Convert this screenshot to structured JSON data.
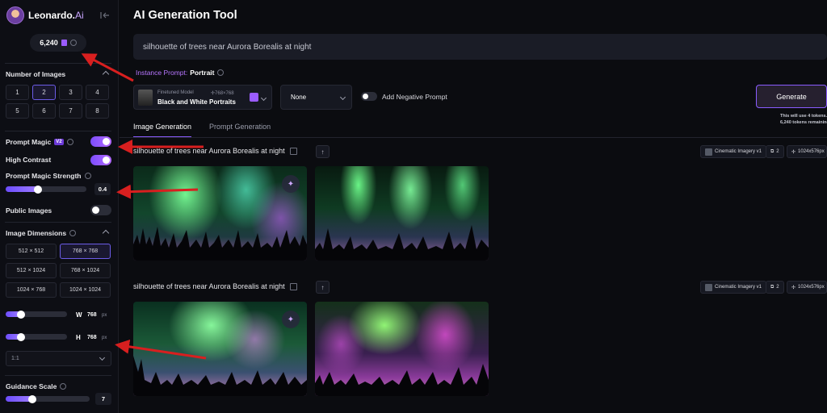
{
  "app": {
    "name": "Leonardo.",
    "name_ai": "Ai",
    "tokens": "6,240"
  },
  "sidebar": {
    "num_images_label": "Number of Images",
    "num_options": [
      "1",
      "2",
      "3",
      "4",
      "5",
      "6",
      "7",
      "8"
    ],
    "num_selected": "2",
    "prompt_magic_label": "Prompt Magic",
    "prompt_magic_badge": "V2",
    "prompt_magic_on": true,
    "high_contrast_label": "High Contrast",
    "high_contrast_on": true,
    "magic_strength_label": "Prompt Magic Strength",
    "magic_strength_value": "0.4",
    "magic_strength_fraction": 0.4,
    "public_images_label": "Public Images",
    "public_images_on": false,
    "dimensions_label": "Image Dimensions",
    "dimensions": [
      "512 × 512",
      "768 × 768",
      "512 × 1024",
      "768 × 1024",
      "1024 × 768",
      "1024 × 1024"
    ],
    "dimension_selected": "768 × 768",
    "width_label": "W",
    "width_value": "768",
    "width_unit": "px",
    "height_label": "H",
    "height_value": "768",
    "height_unit": "px",
    "aspect_ratio": "1:1",
    "guidance_label": "Guidance Scale",
    "guidance_value": "7"
  },
  "main": {
    "title": "AI Generation Tool",
    "prompt": "silhouette of trees near Aurora Borealis at night",
    "instance_label": "Instance Prompt:",
    "instance_value": "Portrait",
    "model_caption": "Finetuned Model",
    "model_dims": "768×768",
    "model_name": "Black and White Portraits",
    "style_select": "None",
    "negative_prompt_label": "Add Negative Prompt",
    "generate_label": "Generate",
    "generate_note_1": "This will use 4 tokens.",
    "generate_note_2": "6,240 tokens remaining.",
    "tabs": [
      "Image Generation",
      "Prompt Generation"
    ],
    "active_tab": "Image Generation",
    "generations": [
      {
        "prompt": "silhouette of trees near Aurora Borealis at night",
        "model": "Cinematic Imagery v1",
        "count": "2",
        "size": "1024x576px"
      },
      {
        "prompt": "silhouette of trees near Aurora Borealis at night",
        "model": "Cinematic Imagery v1",
        "count": "2",
        "size": "1024x576px"
      }
    ]
  },
  "icons": [
    "collapse-icon",
    "token-icon",
    "info-icon",
    "chevron-up-icon",
    "chevron-down-icon",
    "copy-icon",
    "arrow-up-icon",
    "sparkle-icon",
    "model-style-icon",
    "image-count-icon",
    "dimension-icon"
  ],
  "colors": {
    "accent": "#8a5cff",
    "annotation_arrow": "#d81f1f",
    "background": "#0b0c10"
  }
}
